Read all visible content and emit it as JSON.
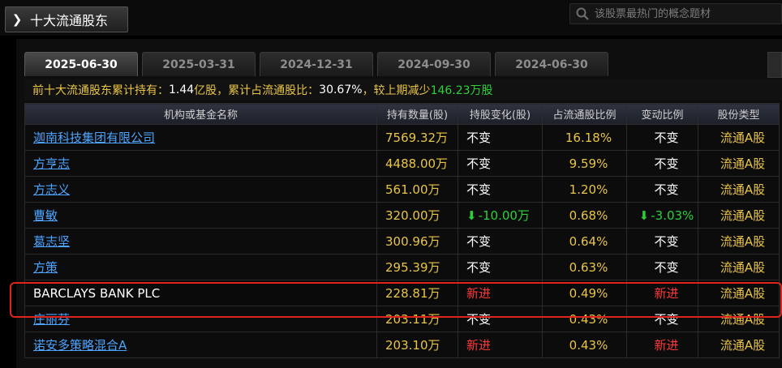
{
  "panel": {
    "title": "十大流通股东"
  },
  "search": {
    "placeholder": "该股票最热门的概念题材"
  },
  "tabs": [
    {
      "label": "2025-06-30",
      "active": true
    },
    {
      "label": "2025-03-31",
      "active": false
    },
    {
      "label": "2024-12-31",
      "active": false
    },
    {
      "label": "2024-09-30",
      "active": false
    },
    {
      "label": "2024-06-30",
      "active": false
    }
  ],
  "summary": {
    "prefix": "前十大流通股东累计持有：",
    "shares": "1.44",
    "shares_unit": "亿股，累计占流通股比：",
    "ratio": "30.67%",
    "mid": "，较上期减少",
    "decrease": "146.23万股"
  },
  "table": {
    "headers": [
      "机构或基金名称",
      "持有数量(股)",
      "持股变化(股)",
      "占流通股比例",
      "变动比例",
      "股份类型"
    ],
    "rows": [
      {
        "name": "迦南科技集团有限公司",
        "link": true,
        "qty": "7569.32万",
        "change": "不变",
        "change_type": "same",
        "ratio": "16.18%",
        "pct": "不变",
        "pct_type": "same",
        "type": "流通A股"
      },
      {
        "name": "方亨志",
        "link": true,
        "qty": "4488.00万",
        "change": "不变",
        "change_type": "same",
        "ratio": "9.59%",
        "pct": "不变",
        "pct_type": "same",
        "type": "流通A股"
      },
      {
        "name": "方志义",
        "link": true,
        "qty": "561.00万",
        "change": "不变",
        "change_type": "same",
        "ratio": "1.20%",
        "pct": "不变",
        "pct_type": "same",
        "type": "流通A股"
      },
      {
        "name": "曹敏",
        "link": true,
        "qty": "320.00万",
        "change": "-10.00万",
        "change_type": "down",
        "ratio": "0.68%",
        "pct": "-3.03%",
        "pct_type": "down",
        "type": "流通A股"
      },
      {
        "name": "葛志坚",
        "link": true,
        "qty": "300.96万",
        "change": "不变",
        "change_type": "same",
        "ratio": "0.64%",
        "pct": "不变",
        "pct_type": "same",
        "type": "流通A股"
      },
      {
        "name": "方策",
        "link": true,
        "qty": "295.39万",
        "change": "不变",
        "change_type": "same",
        "ratio": "0.63%",
        "pct": "不变",
        "pct_type": "same",
        "type": "流通A股"
      },
      {
        "name": "BARCLAYS BANK PLC",
        "link": false,
        "qty": "228.81万",
        "change": "新进",
        "change_type": "new",
        "ratio": "0.49%",
        "pct": "新进",
        "pct_type": "new",
        "type": "流通A股"
      },
      {
        "name": "庄丽芬",
        "link": true,
        "qty": "203.11万",
        "change": "不变",
        "change_type": "same",
        "ratio": "0.43%",
        "pct": "不变",
        "pct_type": "same",
        "type": "流通A股"
      },
      {
        "name": "诺安多策略混合A",
        "link": true,
        "qty": "203.10万",
        "change": "新进",
        "change_type": "new",
        "ratio": "0.43%",
        "pct": "新进",
        "pct_type": "new",
        "type": "流通A股"
      }
    ]
  },
  "colors": {
    "accent_yellow": "#e8c547",
    "link_blue": "#4da4ff",
    "red": "#ff3b3b",
    "green": "#2ed03a",
    "highlight": "#e0241c"
  },
  "icons": {
    "title": "chevron-right-icon",
    "search": "search-icon",
    "down": "arrow-down-icon"
  }
}
